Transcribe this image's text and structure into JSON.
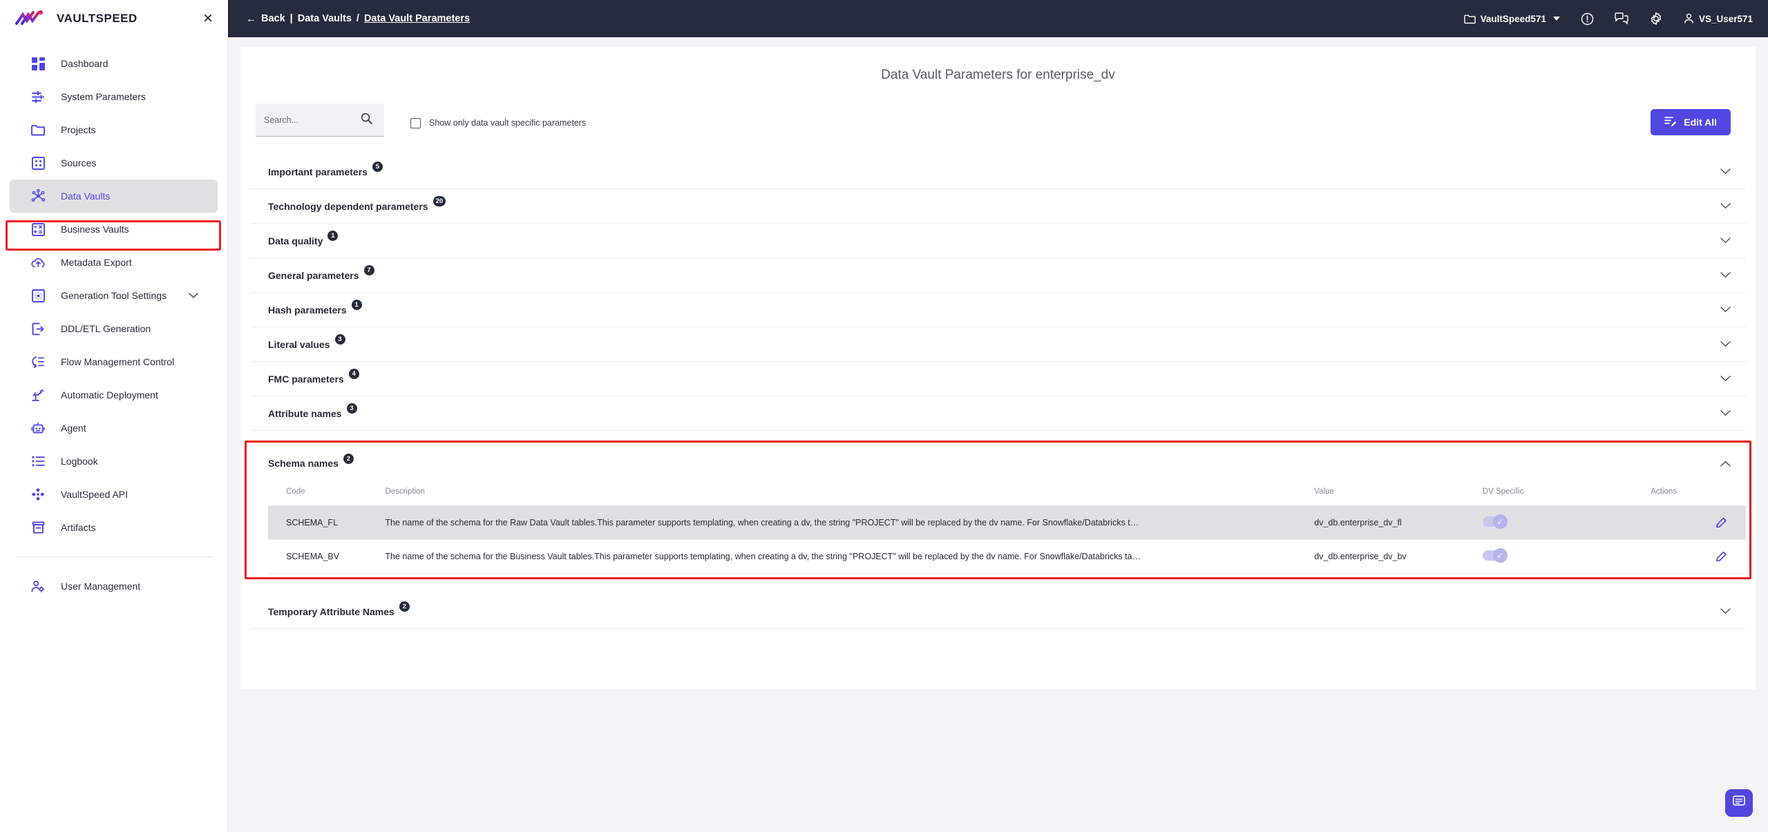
{
  "app": {
    "brand": "VAULTSPEED",
    "close_label": "×"
  },
  "topbar": {
    "back_arrow": "←",
    "back_label": "Back",
    "separator": "|",
    "crumb_parent": "Data Vaults",
    "crumb_slash": "/",
    "crumb_current": "Data Vault Parameters",
    "workspace": "VaultSpeed571",
    "user": "VS_User571",
    "icons": {
      "folder": "folder-icon",
      "info": "info-circle-icon",
      "chat": "chat-icon",
      "gear": "gear-icon",
      "person": "person-icon"
    }
  },
  "sidebar": {
    "items": [
      {
        "label": "Dashboard",
        "icon": "dashboard-icon",
        "active": false,
        "expandable": false
      },
      {
        "label": "System Parameters",
        "icon": "sliders-icon",
        "active": false,
        "expandable": false
      },
      {
        "label": "Projects",
        "icon": "folder-icon",
        "active": false,
        "expandable": false
      },
      {
        "label": "Sources",
        "icon": "grid-icon",
        "active": false,
        "expandable": false
      },
      {
        "label": "Data Vaults",
        "icon": "network-icon",
        "active": true,
        "expandable": false
      },
      {
        "label": "Business Vaults",
        "icon": "calculator-icon",
        "active": false,
        "expandable": false
      },
      {
        "label": "Metadata Export",
        "icon": "cloud-upload-icon",
        "active": false,
        "expandable": false
      },
      {
        "label": "Generation Tool Settings",
        "icon": "settings-square-icon",
        "active": false,
        "expandable": true
      },
      {
        "label": "DDL/ETL Generation",
        "icon": "export-icon",
        "active": false,
        "expandable": false
      },
      {
        "label": "Flow Management Control",
        "icon": "flow-icon",
        "active": false,
        "expandable": false
      },
      {
        "label": "Automatic Deployment",
        "icon": "robot-arm-icon",
        "active": false,
        "expandable": false
      },
      {
        "label": "Agent",
        "icon": "robot-icon",
        "active": false,
        "expandable": false
      },
      {
        "label": "Logbook",
        "icon": "list-icon",
        "active": false,
        "expandable": false
      },
      {
        "label": "VaultSpeed API",
        "icon": "api-icon",
        "active": false,
        "expandable": false
      },
      {
        "label": "Artifacts",
        "icon": "archive-icon",
        "active": false,
        "expandable": false
      }
    ],
    "footer_items": [
      {
        "label": "User Management",
        "icon": "user-gear-icon",
        "active": false,
        "expandable": false
      }
    ]
  },
  "main": {
    "title": "Data Vault Parameters for enterprise_dv",
    "search": {
      "placeholder": "Search...",
      "value": "",
      "icon": "search-icon"
    },
    "checkbox": {
      "label": "Show only data vault specific parameters",
      "checked": false
    },
    "edit_all": {
      "label": "Edit All",
      "icon": "edit-list-icon"
    },
    "sections": [
      {
        "label": "Important parameters",
        "count": "5",
        "expanded": false
      },
      {
        "label": "Technology dependent parameters",
        "count": "20",
        "expanded": false
      },
      {
        "label": "Data quality",
        "count": "1",
        "expanded": false
      },
      {
        "label": "General parameters",
        "count": "7",
        "expanded": false
      },
      {
        "label": "Hash parameters",
        "count": "1",
        "expanded": false
      },
      {
        "label": "Literal values",
        "count": "3",
        "expanded": false
      },
      {
        "label": "FMC parameters",
        "count": "4",
        "expanded": false
      },
      {
        "label": "Attribute names",
        "count": "3",
        "expanded": false
      }
    ],
    "expanded_section": {
      "label": "Schema names",
      "count": "2",
      "expanded": true,
      "columns": [
        "Code",
        "Description",
        "Value",
        "DV Specific",
        "Actions"
      ],
      "rows": [
        {
          "code": "SCHEMA_FL",
          "description": "The name of the schema for the Raw Data Vault tables.This parameter supports templating, when creating a dv, the string \"PROJECT\" will be replaced by the dv name. For Snowflake/Databricks t…",
          "value": "dv_db.enterprise_dv_fl",
          "dv_specific": true,
          "action_icon": "pencil-icon",
          "highlighted": true
        },
        {
          "code": "SCHEMA_BV",
          "description": "The name of the schema for the Business Vault tables.This parameter supports templating, when creating a dv, the string \"PROJECT\" will be replaced by the dv name. For Snowflake/Databricks ta…",
          "value": "dv_db.enterprise_dv_bv",
          "dv_specific": true,
          "action_icon": "pencil-icon",
          "highlighted": false
        }
      ]
    },
    "bottom_section": {
      "label": "Temporary Attribute Names",
      "count": "2",
      "expanded": false
    },
    "fab": {
      "icon": "chat-support-icon"
    }
  },
  "colors": {
    "accent": "#5146e0",
    "topbar_bg": "#262b3d",
    "highlight_outline": "#ee1c1c",
    "badge_bg": "#262b3d",
    "row_highlight": "#e0e0e2"
  }
}
